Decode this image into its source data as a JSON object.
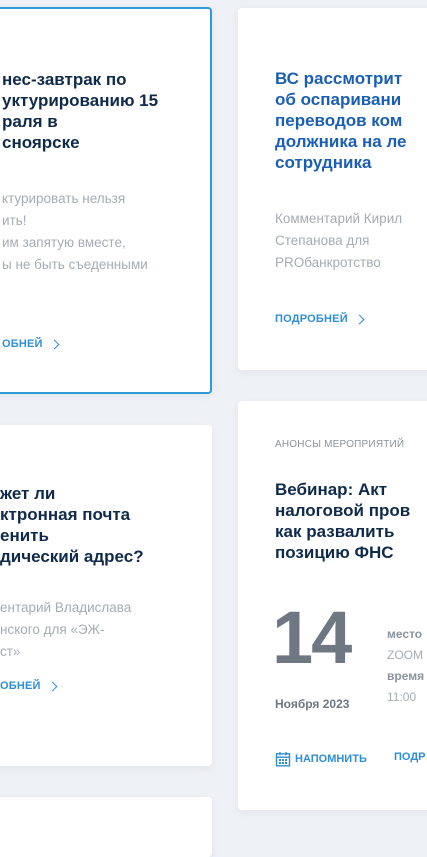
{
  "cards": [
    {
      "title": "нес-завтрак по\nуктурированию 15\nраля в\nсноярске",
      "desc": "ктурировать нельзя\nить!\nим запятую вместе,\nы не быть съеденными",
      "more": "ОБНЕЙ"
    },
    {
      "title": "ВС рассмотрит\nоб оспаривани\nпереводов ком\nдолжника на ле\nсотрудника",
      "desc": "Комментарий Кирил\nСтепанова для\nPROбанкротство",
      "more": "ПОДРОБНЕЙ"
    },
    {
      "title": "жет ли\nктронная почта\nенить\nдический адрес?",
      "desc": "ентарий Владислава\nнского для «ЭЖ-\nст»",
      "more": "ОБНЕЙ"
    },
    {
      "category": "АНОНСЫ МЕРОПРИЯТИЙ",
      "title": "Вебинар: Акт\nналоговой пров\nкак развалить\nпозицию ФНС",
      "day": "14",
      "place_label": "место",
      "place_value": "ZOOM",
      "time_label": "время",
      "time_value": "11:00",
      "month": "Ноября 2023",
      "remind": "НАПОМНИТЬ",
      "more": "ПОДР"
    }
  ],
  "colors": {
    "accent": "#2e8fd6",
    "title_dark": "#0f2a4a",
    "title_blue": "#1a5fb4",
    "muted": "#a6acb4",
    "background": "#eef1f5"
  }
}
